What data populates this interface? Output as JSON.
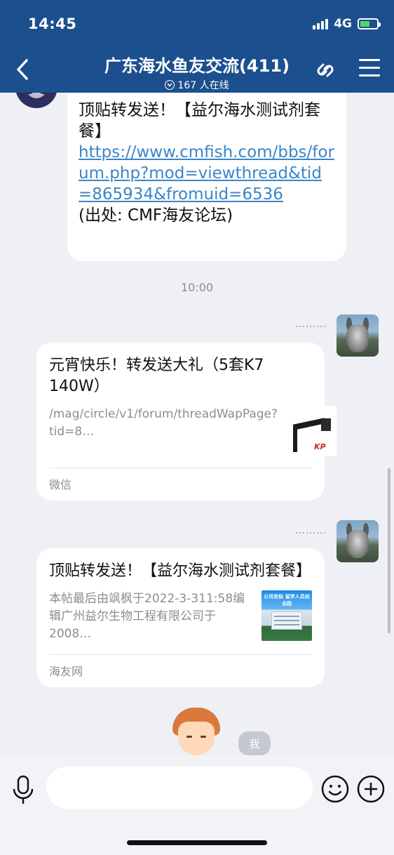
{
  "status_bar": {
    "time": "14:45",
    "network": "4G"
  },
  "header": {
    "title": "广东海水鱼友交流(411)",
    "online": "167 人在线",
    "icons": {
      "back": "chevron-left-icon",
      "link": "link-icon",
      "menu": "menu-icon"
    }
  },
  "messages": {
    "msg1": {
      "title": "顶贴转发送！【益尔海水测试剂套餐】",
      "url": "https://www.cmfish.com/bbs/forum.php?mod=viewthread&tid=865934&fromuid=6536",
      "source": "(出处: CMF海友论坛)"
    },
    "timestamp": "10:00",
    "sender_name_hidden": "………",
    "card1": {
      "title": "元宵快乐！转发送大礼（5套K7 140W）",
      "desc": "/mag/circle/v1/forum/threadWapPage?tid=8…",
      "source": "微信"
    },
    "card2": {
      "title": "顶贴转发送！【益尔海水测试剂套餐】",
      "desc": "本帖最后由飒枫于2022-3-311:58编辑广州益尔生物工程有限公司于2008…",
      "source": "海友网",
      "thumb_caption": "公司坐标 留学人员创业园"
    },
    "me_badge": "我"
  },
  "input": {
    "placeholder": ""
  },
  "colors": {
    "header_bg": "#1c4f8e",
    "link": "#3a86c8",
    "chat_bg": "#eef0f5"
  }
}
